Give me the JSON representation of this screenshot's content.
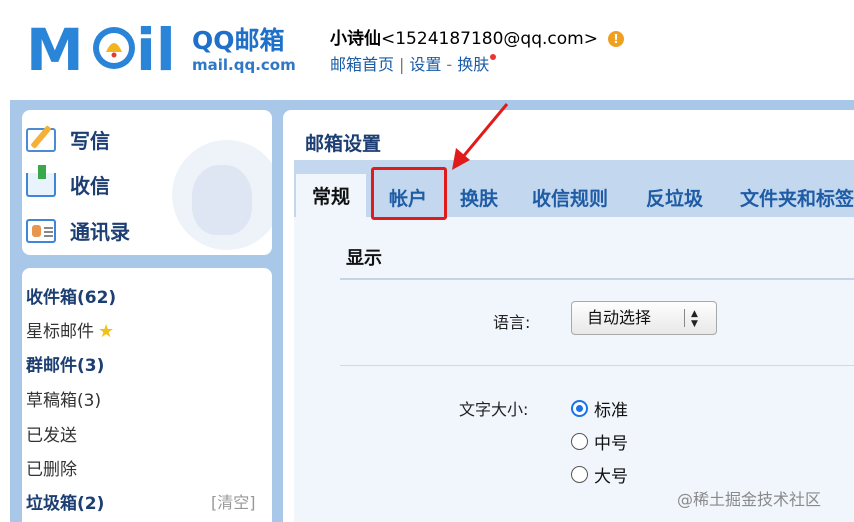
{
  "header": {
    "logo_mail": "M",
    "logo_mail_rest": "il",
    "logo_brand": "QQ邮箱",
    "logo_domain": "mail.qq.com",
    "user_name": "小诗仙",
    "user_email": "<1524187180@qq.com>",
    "warn_icon": "!",
    "links": {
      "home": "邮箱首页",
      "sep1": "|",
      "settings": "设置",
      "sep2": "-",
      "skin": "换肤"
    }
  },
  "nav": {
    "actions": [
      {
        "label": "写信",
        "icon": "pen-paper-icon"
      },
      {
        "label": "收信",
        "icon": "inbox-download-icon"
      },
      {
        "label": "通讯录",
        "icon": "contact-card-icon"
      }
    ],
    "folders": [
      {
        "label": "收件箱(62)",
        "bold": true
      },
      {
        "label": "星标邮件",
        "icon": "star-icon",
        "star": "★",
        "bold": false
      },
      {
        "label": "群邮件(3)",
        "bold": true
      },
      {
        "label": "草稿箱(3)",
        "bold": false
      },
      {
        "label": "已发送",
        "bold": false
      },
      {
        "label": "已删除",
        "bold": false
      },
      {
        "label": "垃圾箱(2)",
        "bold": true
      }
    ],
    "clear_label": "[清空]"
  },
  "main": {
    "title": "邮箱设置",
    "tabs": [
      "常规",
      "帐户",
      "换肤",
      "收信规则",
      "反垃圾",
      "文件夹和标签"
    ],
    "active_tab": "常规",
    "highlighted_tab": "帐户",
    "section_title": "显示",
    "language": {
      "label": "语言:",
      "value": "自动选择",
      "arrows": "▲▼"
    },
    "font_size": {
      "label": "文字大小:",
      "options": [
        "标准",
        "中号",
        "大号"
      ],
      "selected": "标准"
    }
  },
  "annotation": {
    "color": "#e01b1b"
  },
  "watermark": "@稀土掘金技术社区"
}
